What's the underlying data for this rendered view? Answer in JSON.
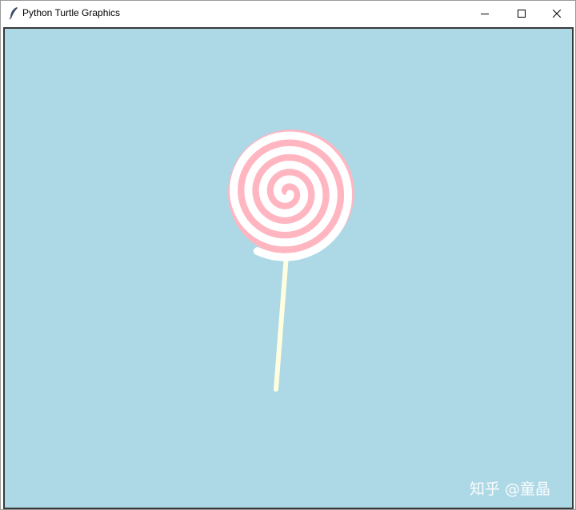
{
  "window": {
    "title": "Python Turtle Graphics"
  },
  "icons": {
    "app": "feather-icon",
    "minimize": "minimize-icon",
    "maximize": "maximize-icon",
    "close": "close-icon"
  },
  "canvas": {
    "background_color": "#add8e6"
  },
  "lollipop": {
    "candy_color": "#ffb6c1",
    "swirl_color": "#ffffff",
    "stick_color": "#ffffe0"
  },
  "watermark": {
    "text": "知乎 @童晶"
  }
}
